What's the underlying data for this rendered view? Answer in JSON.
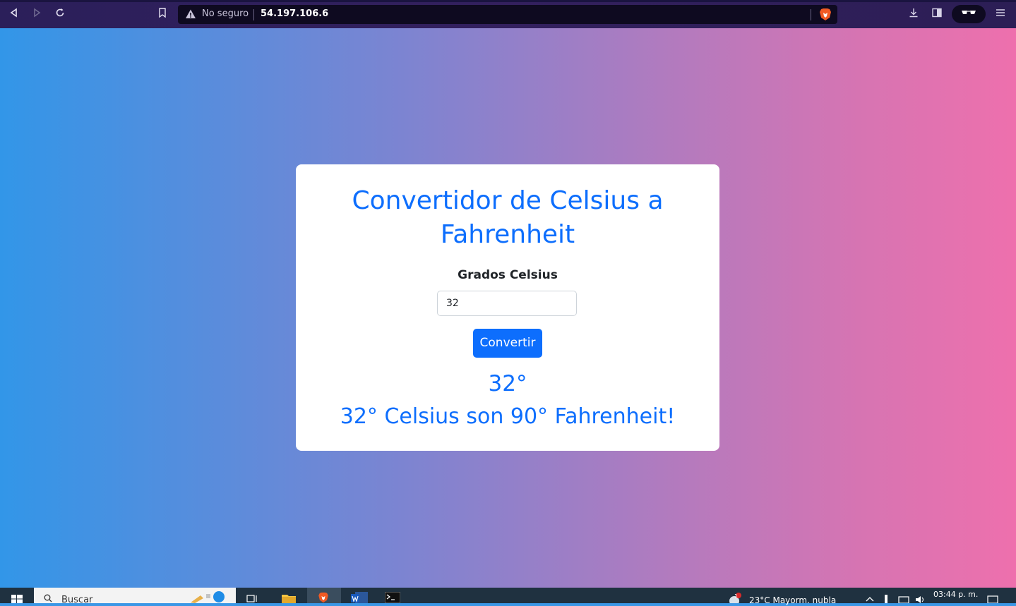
{
  "browser": {
    "security_label": "No seguro",
    "url": "54.197.106.6"
  },
  "card": {
    "title": "Convertidor de Celsius a Fahrenheit",
    "input_label": "Grados Celsius",
    "input_value": "32",
    "button_label": "Convertir",
    "degrees_display": "32°",
    "result_text": "32° Celsius son 90° Fahrenheit!"
  },
  "taskbar": {
    "search_placeholder": "Buscar",
    "weather": "23°C  Mayorm. nubla",
    "notification_count": "1",
    "clock": "03:44 p. m."
  },
  "colors": {
    "accent": "#0d6efd",
    "gradient_start": "#3296e8",
    "gradient_end": "#ee70ad"
  }
}
